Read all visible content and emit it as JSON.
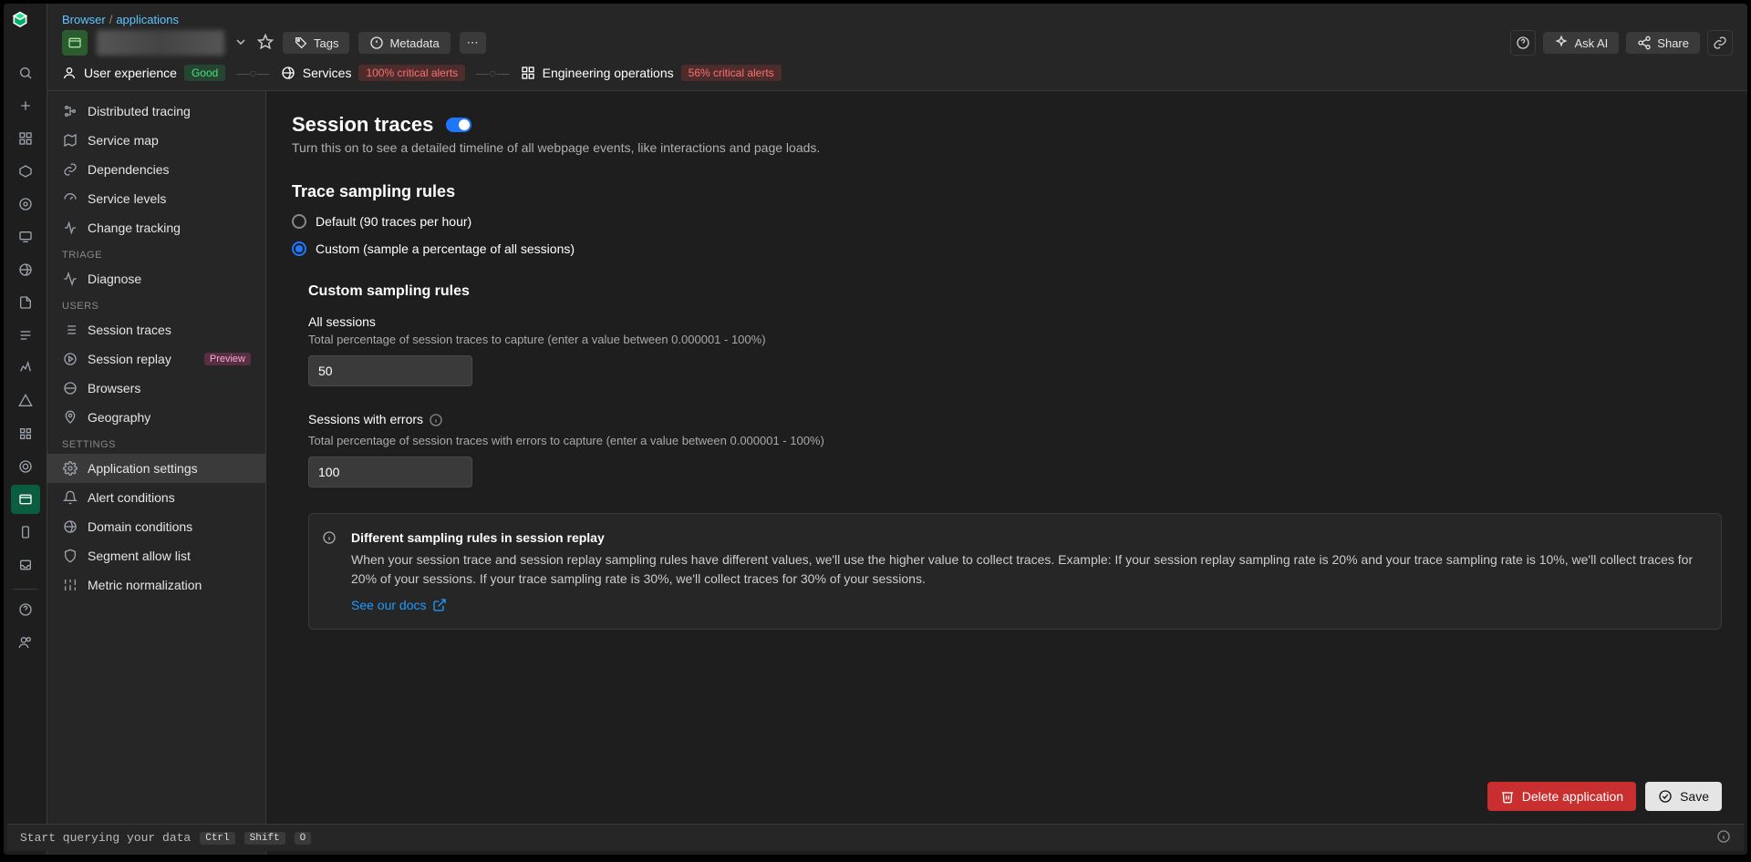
{
  "breadcrumb": {
    "root": "Browser",
    "slash": "/",
    "leaf": "applications"
  },
  "header": {
    "tags_label": "Tags",
    "metadata_label": "Metadata",
    "ask_ai": "Ask AI",
    "share": "Share"
  },
  "status": {
    "ux_label": "User experience",
    "ux_badge": "Good",
    "services_label": "Services",
    "services_badge": "100% critical alerts",
    "eng_label": "Engineering operations",
    "eng_badge": "56% critical alerts"
  },
  "sidebar": {
    "items_top": [
      {
        "label": "Distributed tracing",
        "icon": "tree"
      },
      {
        "label": "Service map",
        "icon": "map"
      },
      {
        "label": "Dependencies",
        "icon": "link"
      },
      {
        "label": "Service levels",
        "icon": "gauge"
      },
      {
        "label": "Change tracking",
        "icon": "pulse"
      }
    ],
    "group_triage": "TRIAGE",
    "triage_items": [
      {
        "label": "Diagnose",
        "icon": "activity"
      }
    ],
    "group_users": "USERS",
    "users_items": [
      {
        "label": "Session traces",
        "icon": "list"
      },
      {
        "label": "Session replay",
        "icon": "play",
        "badge": "Preview"
      },
      {
        "label": "Browsers",
        "icon": "globe"
      },
      {
        "label": "Geography",
        "icon": "mappin"
      }
    ],
    "group_settings": "SETTINGS",
    "settings_items": [
      {
        "label": "Application settings",
        "icon": "gear",
        "active": true
      },
      {
        "label": "Alert conditions",
        "icon": "bell"
      },
      {
        "label": "Domain conditions",
        "icon": "world"
      },
      {
        "label": "Segment allow list",
        "icon": "shield"
      },
      {
        "label": "Metric normalization",
        "icon": "sliders"
      }
    ]
  },
  "main": {
    "session_traces_title": "Session traces",
    "session_traces_desc": "Turn this on to see a detailed timeline of all webpage events, like interactions and page loads.",
    "trace_rules_title": "Trace sampling rules",
    "radio_default": "Default (90 traces per hour)",
    "radio_custom": "Custom (sample a percentage of all sessions)",
    "custom_title": "Custom sampling rules",
    "all_sessions_label": "All sessions",
    "all_sessions_desc": "Total percentage of session traces to capture (enter a value between 0.000001 - 100%)",
    "all_sessions_value": "50",
    "errors_label": "Sessions with errors",
    "errors_desc": "Total percentage of session traces with errors to capture (enter a value between 0.000001 - 100%)",
    "errors_value": "100",
    "callout_title": "Different sampling rules in session replay",
    "callout_body": "When your session trace and session replay sampling rules have different values, we'll use the higher value to collect traces. Example: If your session replay sampling rate is 20% and your trace sampling rate is 10%, we'll collect traces for 20% of your sessions. If your trace sampling rate is 30%, we'll collect traces for 30% of your sessions.",
    "callout_link": "See our docs",
    "delete_btn": "Delete application",
    "save_btn": "Save"
  },
  "omnibar": {
    "prompt": "Start querying your data",
    "k1": "Ctrl",
    "k2": "Shift",
    "k3": "O"
  },
  "colors": {
    "accent": "#1f76ff",
    "danger": "#c92f2f"
  }
}
